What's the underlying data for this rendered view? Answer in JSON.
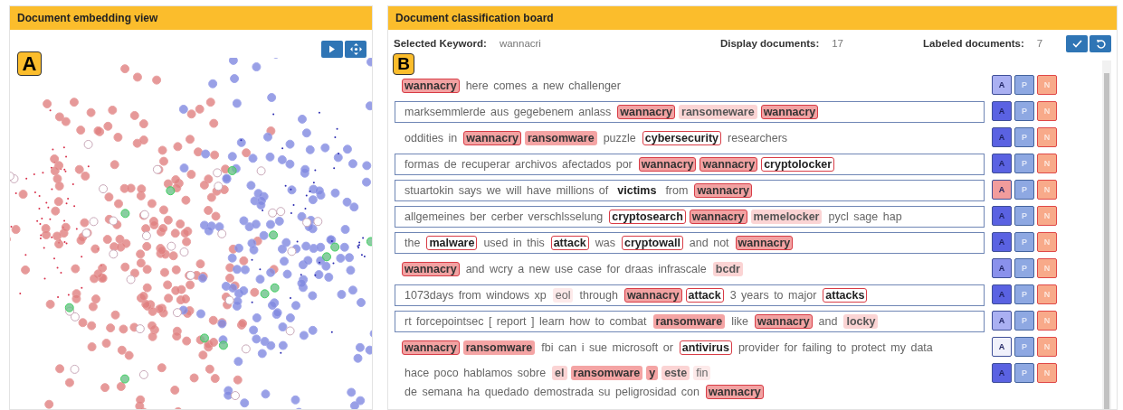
{
  "embedding_view": {
    "title": "Document embedding view",
    "badge": "A",
    "buttons": [
      {
        "kind": "play"
      },
      {
        "kind": "move"
      }
    ]
  },
  "classification_board": {
    "title": "Document classification board",
    "badge": "B",
    "keyword_label": "Selected Keyword:",
    "keyword": "wannacri",
    "display_label": "Display documents:",
    "display_count": "17",
    "labeled_label": "Labeled documents:",
    "labeled_count": "7",
    "buttons": [
      {
        "kind": "confirm"
      },
      {
        "kind": "undo"
      }
    ],
    "documents": [
      {
        "boxed": false,
        "color": "#aab0f2",
        "labels": [
          "A",
          "P",
          "N"
        ],
        "tokens": [
          {
            "text": "wannacry",
            "kind": "keyword"
          },
          {
            "text": "here comes a new challenger",
            "kind": "plain"
          }
        ]
      },
      {
        "boxed": true,
        "color": "#5a62e2",
        "labels": [
          "A",
          "P",
          "N"
        ],
        "tokens": [
          {
            "text": "marksemmlerde aus gegebenem anlass",
            "kind": "plain"
          },
          {
            "text": "wannacry",
            "kind": "keyword"
          },
          {
            "text": "ransomeware",
            "kind": "light"
          },
          {
            "text": "wannacry",
            "kind": "keyword"
          }
        ]
      },
      {
        "boxed": false,
        "color": "#5a62e2",
        "labels": [
          "A",
          "P",
          "N"
        ],
        "tokens": [
          {
            "text": "oddities in",
            "kind": "plain"
          },
          {
            "text": "wannacry",
            "kind": "keyword"
          },
          {
            "text": "ransomware",
            "kind": "fill"
          },
          {
            "text": "puzzle",
            "kind": "plain"
          },
          {
            "text": "cybersecurity",
            "kind": "outline"
          },
          {
            "text": "researchers",
            "kind": "plain"
          }
        ]
      },
      {
        "boxed": true,
        "color": "#5a62e2",
        "labels": [
          "A",
          "P",
          "N"
        ],
        "tokens": [
          {
            "text": "formas de recuperar archivos afectados por",
            "kind": "plain"
          },
          {
            "text": "wannacry",
            "kind": "keyword"
          },
          {
            "text": "wannacry",
            "kind": "keyword"
          },
          {
            "text": "cryptolocker",
            "kind": "outline"
          }
        ]
      },
      {
        "boxed": true,
        "color": "#f29c9c",
        "labels": [
          "A",
          "P",
          "N"
        ],
        "tokens": [
          {
            "text": "stuartokin says we will have millions of",
            "kind": "plain"
          },
          {
            "text": "victims",
            "kind": "bold"
          },
          {
            "text": "from",
            "kind": "plain"
          },
          {
            "text": "wannacry",
            "kind": "keyword"
          }
        ]
      },
      {
        "boxed": true,
        "color": "#5a62e2",
        "labels": [
          "A",
          "P",
          "N"
        ],
        "tokens": [
          {
            "text": "allgemeines ber cerber verschlsselung",
            "kind": "plain"
          },
          {
            "text": "cryptosearch",
            "kind": "outline"
          },
          {
            "text": "wannacry",
            "kind": "keyword"
          },
          {
            "text": "memelocker",
            "kind": "light"
          },
          {
            "text": "pycl sage hap",
            "kind": "plain"
          }
        ]
      },
      {
        "boxed": true,
        "color": "#5a62e2",
        "labels": [
          "A",
          "P",
          "N"
        ],
        "tokens": [
          {
            "text": "the",
            "kind": "plain"
          },
          {
            "text": "malware",
            "kind": "outline"
          },
          {
            "text": "used in this",
            "kind": "plain"
          },
          {
            "text": "attack",
            "kind": "outline"
          },
          {
            "text": "was",
            "kind": "plain"
          },
          {
            "text": "cryptowall",
            "kind": "outline"
          },
          {
            "text": "and not",
            "kind": "plain"
          },
          {
            "text": "wannacry",
            "kind": "keyword"
          }
        ]
      },
      {
        "boxed": false,
        "color": "#8a91ec",
        "labels": [
          "A",
          "P",
          "N"
        ],
        "tokens": [
          {
            "text": "wannacry",
            "kind": "keyword"
          },
          {
            "text": "and wcry a new use case for draas infrascale",
            "kind": "plain"
          },
          {
            "text": "bcdr",
            "kind": "light"
          }
        ]
      },
      {
        "boxed": true,
        "color": "#5a62e2",
        "labels": [
          "A",
          "P",
          "N"
        ],
        "tokens": [
          {
            "text": "1073days from windows xp",
            "kind": "plain"
          },
          {
            "text": "eol",
            "kind": "faint"
          },
          {
            "text": "through",
            "kind": "plain"
          },
          {
            "text": "wannacry",
            "kind": "keyword"
          },
          {
            "text": "attack",
            "kind": "outline"
          },
          {
            "text": "3 years to major",
            "kind": "plain"
          },
          {
            "text": "attacks",
            "kind": "outline"
          }
        ]
      },
      {
        "boxed": true,
        "color": "#aab0f2",
        "labels": [
          "A",
          "P",
          "N"
        ],
        "tokens": [
          {
            "text": "rt forcepointsec [ report ] learn how to combat",
            "kind": "plain"
          },
          {
            "text": "ransomware",
            "kind": "fill"
          },
          {
            "text": "like",
            "kind": "plain"
          },
          {
            "text": "wannacry",
            "kind": "keyword"
          },
          {
            "text": "and",
            "kind": "plain"
          },
          {
            "text": "locky",
            "kind": "light"
          }
        ]
      },
      {
        "boxed": false,
        "color": "#f0f1fb",
        "labels": [
          "A",
          "P",
          "N"
        ],
        "tokens": [
          {
            "text": "wannacry",
            "kind": "keyword"
          },
          {
            "text": "ransomware",
            "kind": "fill"
          },
          {
            "text": "fbi can i sue microsoft or",
            "kind": "plain"
          },
          {
            "text": "antivirus",
            "kind": "outline"
          },
          {
            "text": "provider for failing to protect my data",
            "kind": "plain"
          }
        ]
      },
      {
        "boxed": false,
        "color": "#5a62e2",
        "labels": [
          "A",
          "P",
          "N"
        ],
        "tokens": [
          {
            "text": "hace poco hablamos sobre",
            "kind": "plain"
          },
          {
            "text": "el",
            "kind": "light"
          },
          {
            "text": "ransomware",
            "kind": "fill"
          },
          {
            "text": "y",
            "kind": "fill"
          },
          {
            "text": "este",
            "kind": "light"
          },
          {
            "text": "fin",
            "kind": "faint"
          },
          {
            "text": "de semana ha quedado demostrada su peligrosidad con",
            "kind": "plain"
          },
          {
            "text": "wannacry",
            "kind": "keyword"
          }
        ]
      }
    ]
  }
}
